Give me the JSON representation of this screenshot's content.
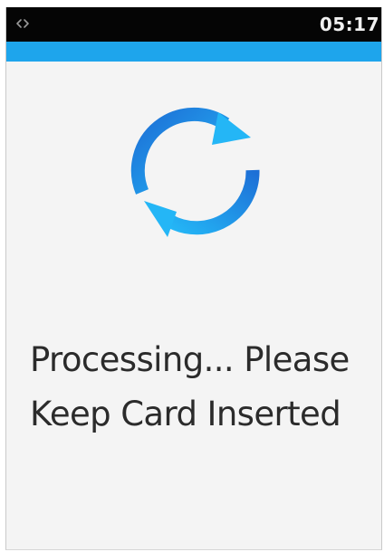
{
  "status_bar": {
    "time": "05:17",
    "left_icon": "sync-arrows-icon"
  },
  "spinner": {
    "icon": "processing-spinner-icon"
  },
  "message": {
    "line1": "Processing... Please",
    "line2": "Keep Card Inserted"
  },
  "colors": {
    "status_bar_bg": "#050505",
    "accent": "#1ea5ec",
    "spinner_light": "#24b6f6",
    "spinner_dark": "#1d6fd6",
    "background": "#f4f4f4",
    "text": "#2b2b2b"
  }
}
